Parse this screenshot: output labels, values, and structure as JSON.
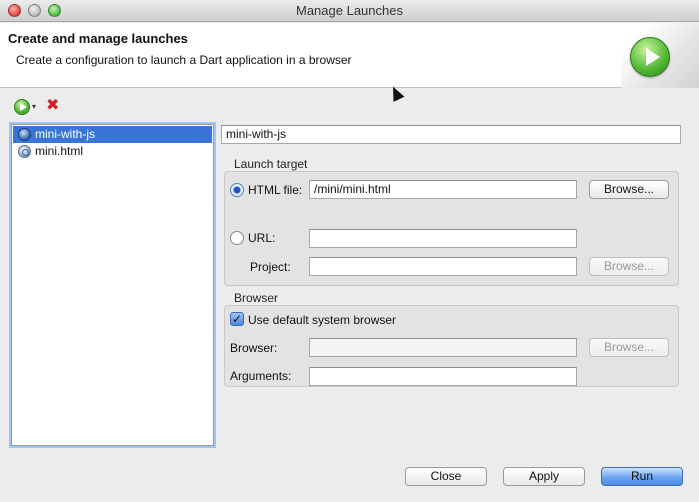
{
  "window": {
    "title": "Manage Launches"
  },
  "header": {
    "title": "Create and manage launches",
    "subtitle": "Create a configuration to launch a Dart application in a browser"
  },
  "toolbar": {
    "new_icon": "run-launch-icon",
    "dropdown_icon": "chevron-down-icon",
    "delete_icon": "delete-x-icon",
    "dropdown_glyph": "▾",
    "delete_glyph": "✖"
  },
  "launches": [
    {
      "label": "mini-with-js",
      "icon": "globe-icon",
      "selected": true
    },
    {
      "label": "mini.html",
      "icon": "dart-file-icon",
      "selected": false
    }
  ],
  "config": {
    "name": "mini-with-js",
    "launch_target": {
      "label": "Launch target",
      "html_file_label": "HTML file:",
      "html_file_value": "/mini/mini.html",
      "html_file_selected": true,
      "url_label": "URL:",
      "url_value": "",
      "project_label": "Project:",
      "project_value": "",
      "browse_label": "Browse..."
    },
    "browser": {
      "label": "Browser",
      "use_default_label": "Use default system browser",
      "use_default_checked": true,
      "browser_label": "Browser:",
      "browser_value": "",
      "arguments_label": "Arguments:",
      "arguments_value": "",
      "browse_label": "Browse...",
      "check_glyph": "✓"
    }
  },
  "footer": {
    "close_label": "Close",
    "apply_label": "Apply",
    "run_label": "Run"
  },
  "colors": {
    "selection": "#3875d7",
    "accent": "#4b8de6",
    "delete": "#d61f1f",
    "run_icon": "#4fb532"
  }
}
